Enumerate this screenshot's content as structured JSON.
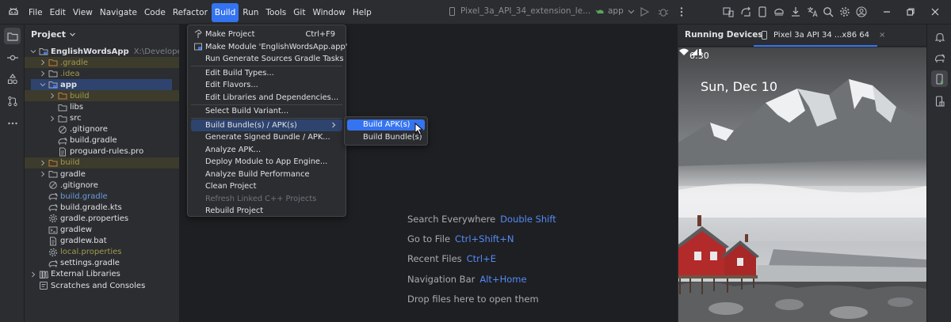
{
  "window": {
    "menu": [
      "File",
      "Edit",
      "View",
      "Navigate",
      "Code",
      "Refactor",
      "Build",
      "Run",
      "Tools",
      "Git",
      "Window",
      "Help"
    ],
    "active_menu": "Build",
    "run_config": "Pixel_3a_API_34_extension_le...",
    "app_config": "app"
  },
  "project": {
    "header": "Project",
    "tree": [
      {
        "label": "EnglishWordsApp",
        "path": "X:\\Developer\\Andr",
        "indent": 0,
        "chevron": "down",
        "icon": "module",
        "style": "bold"
      },
      {
        "label": ".gradle",
        "indent": 1,
        "chevron": "right",
        "icon": "folder-ignored",
        "style": "ignored",
        "highlight": "ignored"
      },
      {
        "label": ".idea",
        "indent": 1,
        "chevron": "right",
        "icon": "folder",
        "style": "ignored"
      },
      {
        "label": "app",
        "indent": 1,
        "chevron": "down",
        "icon": "module",
        "style": "bold",
        "highlight": "selected"
      },
      {
        "label": "build",
        "indent": 2,
        "chevron": "right",
        "icon": "folder-ignored",
        "style": "ignored",
        "highlight": "ignored"
      },
      {
        "label": "libs",
        "indent": 2,
        "chevron": "",
        "icon": "folder",
        "style": ""
      },
      {
        "label": "src",
        "indent": 2,
        "chevron": "right",
        "icon": "folder",
        "style": ""
      },
      {
        "label": ".gitignore",
        "indent": 2,
        "chevron": "",
        "icon": "ignore-file",
        "style": ""
      },
      {
        "label": "build.gradle",
        "indent": 2,
        "chevron": "",
        "icon": "gradle",
        "style": ""
      },
      {
        "label": "proguard-rules.pro",
        "indent": 2,
        "chevron": "",
        "icon": "text-file",
        "style": ""
      },
      {
        "label": "build",
        "indent": 1,
        "chevron": "right",
        "icon": "folder-ignored",
        "style": "ignored",
        "highlight": "ignored"
      },
      {
        "label": "gradle",
        "indent": 1,
        "chevron": "right",
        "icon": "folder",
        "style": ""
      },
      {
        "label": ".gitignore",
        "indent": 1,
        "chevron": "",
        "icon": "ignore-file",
        "style": ""
      },
      {
        "label": "build.gradle",
        "indent": 1,
        "chevron": "",
        "icon": "gradle",
        "style": "blue"
      },
      {
        "label": "build.gradle.kts",
        "indent": 1,
        "chevron": "",
        "icon": "gradle",
        "style": ""
      },
      {
        "label": "gradle.properties",
        "indent": 1,
        "chevron": "",
        "icon": "settings-file",
        "style": ""
      },
      {
        "label": "gradlew",
        "indent": 1,
        "chevron": "",
        "icon": "terminal-file",
        "style": ""
      },
      {
        "label": "gradlew.bat",
        "indent": 1,
        "chevron": "",
        "icon": "text-file",
        "style": ""
      },
      {
        "label": "local.properties",
        "indent": 1,
        "chevron": "",
        "icon": "settings-file",
        "style": "ignored"
      },
      {
        "label": "settings.gradle",
        "indent": 1,
        "chevron": "",
        "icon": "gradle",
        "style": ""
      },
      {
        "label": "External Libraries",
        "indent": 0,
        "chevron": "right",
        "icon": "libraries",
        "style": ""
      },
      {
        "label": "Scratches and Consoles",
        "indent": 0,
        "chevron": "",
        "icon": "scratches",
        "style": ""
      }
    ]
  },
  "build_menu": {
    "items": [
      {
        "label": "Make Project",
        "shortcut": "Ctrl+F9",
        "icon": "hammer-icon"
      },
      {
        "label": "Make Module 'EnglishWordsApp.app'",
        "shortcut": "",
        "icon": "module-icon"
      },
      {
        "label": "Run Generate Sources Gradle Tasks",
        "shortcut": "",
        "icon": ""
      },
      {
        "separator": true
      },
      {
        "label": "Edit Build Types...",
        "shortcut": "",
        "icon": ""
      },
      {
        "label": "Edit Flavors...",
        "shortcut": "",
        "icon": ""
      },
      {
        "label": "Edit Libraries and Dependencies...",
        "shortcut": "",
        "icon": ""
      },
      {
        "separator": true
      },
      {
        "label": "Select Build Variant...",
        "shortcut": "",
        "icon": ""
      },
      {
        "separator": true
      },
      {
        "label": "Build Bundle(s) / APK(s)",
        "shortcut": "",
        "icon": "",
        "submenu": true,
        "active": true
      },
      {
        "label": "Generate Signed Bundle / APK...",
        "shortcut": "",
        "icon": ""
      },
      {
        "label": "Analyze APK...",
        "shortcut": "",
        "icon": ""
      },
      {
        "label": "Deploy Module to App Engine...",
        "shortcut": "",
        "icon": ""
      },
      {
        "label": "Analyze Build Performance",
        "shortcut": "",
        "icon": ""
      },
      {
        "label": "Clean Project",
        "shortcut": "",
        "icon": ""
      },
      {
        "label": "Refresh Linked C++ Projects",
        "shortcut": "",
        "icon": "",
        "disabled": true
      },
      {
        "label": "Rebuild Project",
        "shortcut": "",
        "icon": ""
      }
    ],
    "submenu": [
      {
        "label": "Build APK(s)",
        "hover": true
      },
      {
        "label": "Build Bundle(s)"
      }
    ]
  },
  "editor": {
    "hints": [
      {
        "text": "Search Everywhere",
        "key": "Double Shift"
      },
      {
        "text": "Go to File",
        "key": "Ctrl+Shift+N"
      },
      {
        "text": "Recent Files",
        "key": "Ctrl+E"
      },
      {
        "text": "Navigation Bar",
        "key": "Alt+Home"
      },
      {
        "text": "Drop files here to open them",
        "key": ""
      }
    ]
  },
  "devices": {
    "title": "Running Devices",
    "tab_label": "Pixel 3a API 34 ...x86 64",
    "tab_close": "×",
    "phone_time": "6:30",
    "phone_date": "Sun, Dec 10"
  },
  "colors": {
    "accent": "#3574f0",
    "selection": "#2e436e",
    "ignored_text": "#a09a4d",
    "link_key": "#548af7"
  }
}
